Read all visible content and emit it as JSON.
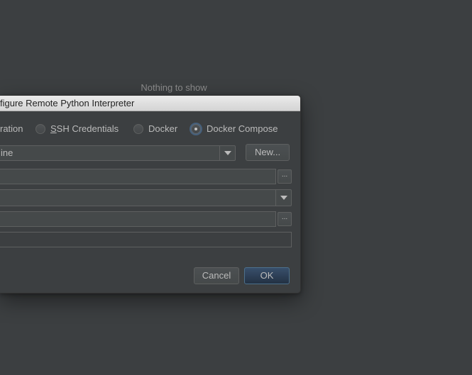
{
  "background": {
    "empty_text": "Nothing to show"
  },
  "dialog": {
    "title": "figure Remote Python Interpreter",
    "radios": [
      {
        "label": "ration",
        "selected": false
      },
      {
        "label_prefix": "",
        "mnemonic": "S",
        "label_rest": "SH Credentials",
        "selected": false
      },
      {
        "label": "Docker",
        "selected": false
      },
      {
        "label": "Docker Compose",
        "selected": true
      }
    ],
    "server_combo_value": "ine",
    "new_button": "New...",
    "browse_label": "...",
    "cancel_button": "Cancel",
    "ok_button": "OK"
  },
  "colors": {
    "background": "#3c3f41",
    "titlebar": "#e0e0e0",
    "default_button": "#2f4258"
  }
}
